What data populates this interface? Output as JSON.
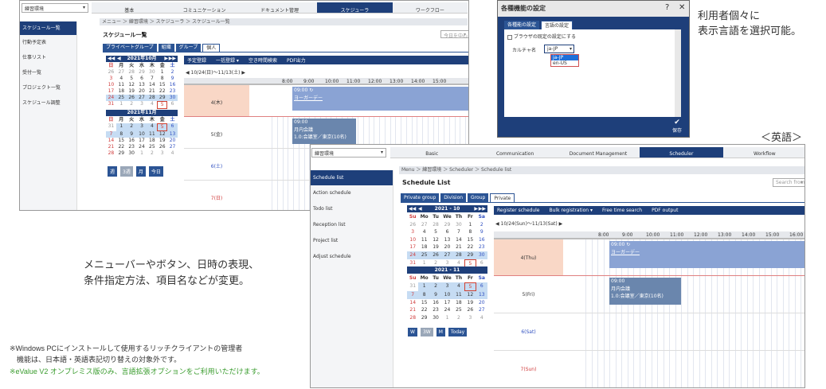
{
  "jp": {
    "select_value": "練習環境",
    "nav": [
      "基本",
      "コミュニケーション",
      "ドキュメント管理",
      "スケジューラ",
      "ワークフロー"
    ],
    "nav_active": 3,
    "side": [
      "スケジュール一覧",
      "行動予定表",
      "仕事リスト",
      "受付一覧",
      "プロジェクト一覧",
      "スケジュール調整"
    ],
    "breadcrumb": "メニュー ＞ 練習環境 ＞ スケジューラ ＞ スケジュール一覧",
    "title": "スケジュール一覧",
    "search_placeholder": "今日を中心",
    "tabs": [
      "プライベートグループ",
      "組織",
      "グループ",
      "個人"
    ],
    "toolbar": [
      "予定登録",
      "一括登録 ▾",
      "空き時間検索",
      "PDF出力"
    ],
    "range": "10/24(日)〜11/13(土)",
    "month1": "2021年10月",
    "month2": "2021年11月",
    "dow": [
      "日",
      "月",
      "火",
      "水",
      "木",
      "金",
      "土"
    ],
    "view_buttons": [
      "週",
      "3週",
      "月",
      "今日"
    ],
    "hours": [
      "8:00",
      "9:00",
      "10:00",
      "11:00",
      "12:00",
      "13:00",
      "14:00",
      "15:00"
    ],
    "days": [
      "4(木)",
      "5(金)",
      "6(土)",
      "7(日)"
    ],
    "ev1_time": "09:00",
    "ev1_text": "ヨーガーデー",
    "ev2_time": "09:00",
    "ev2_title": "月内会議",
    "ev2_room": "1.0:会議室／東京(10名)"
  },
  "en": {
    "select_value": "練習環境",
    "nav": [
      "Basic",
      "Communication",
      "Document Management",
      "Scheduler",
      "Workflow"
    ],
    "nav_active": 3,
    "side": [
      "Schedule list",
      "Action schedule",
      "Todo list",
      "Reception list",
      "Project list",
      "Adjust schedule"
    ],
    "breadcrumb": "Menu ＞ 練習環境 ＞ Scheduler ＞ Schedule list",
    "title": "Schedule List",
    "search_placeholder": "Search from",
    "tabs": [
      "Private group",
      "Division",
      "Group",
      "Private"
    ],
    "toolbar": [
      "Register schedule",
      "Bulk registration ▾",
      "Free time search",
      "PDF output"
    ],
    "range": "10/24(Sun)〜11/13(Sat)",
    "month1": "2021 - 10",
    "month2": "2021 - 11",
    "dow": [
      "Su",
      "Mo",
      "Tu",
      "We",
      "Th",
      "Fr",
      "Sa"
    ],
    "view_buttons": [
      "W",
      "3W",
      "M",
      "Today"
    ],
    "hours": [
      "8:00",
      "9:00",
      "10:00",
      "11:00",
      "12:00",
      "13:00",
      "14:00",
      "15:00",
      "16:00"
    ],
    "days": [
      "4(Thu)",
      "5(Fri)",
      "6(Sat)",
      "7(Sun)"
    ],
    "ev1_time": "09:00",
    "ev1_text": "ヨーガーデー",
    "ev2_time": "09:00",
    "ev2_title": "月内会議",
    "ev2_room": "1.0:会議室／東京(10名)"
  },
  "oct": [
    "26",
    "27",
    "28",
    "29",
    "30",
    "1",
    "2",
    "3",
    "4",
    "5",
    "6",
    "7",
    "8",
    "9",
    "10",
    "11",
    "12",
    "13",
    "14",
    "15",
    "16",
    "17",
    "18",
    "19",
    "20",
    "21",
    "22",
    "23",
    "24",
    "25",
    "26",
    "27",
    "28",
    "29",
    "30",
    "31",
    "1",
    "2",
    "3",
    "4",
    "5",
    "6"
  ],
  "nov": [
    "31",
    "1",
    "2",
    "3",
    "4",
    "5",
    "6",
    "7",
    "8",
    "9",
    "10",
    "11",
    "12",
    "13",
    "14",
    "15",
    "16",
    "17",
    "18",
    "19",
    "20",
    "21",
    "22",
    "23",
    "24",
    "25",
    "26",
    "27",
    "28",
    "29",
    "30",
    "1",
    "2",
    "3",
    "4"
  ],
  "dialog": {
    "title": "各種機能の設定",
    "help": "?",
    "close": "✕",
    "tabs": [
      "各種能の設定",
      "言語の設定"
    ],
    "checkbox_label": "ブラウザの既定の設定にする",
    "culture_label": "カルチャ名",
    "culture_value": "ja-JP",
    "options": [
      "ja-JP",
      "en-US"
    ],
    "save_label": "保存"
  },
  "captions": {
    "right1": "利用者個々に",
    "right2": "表示言語を選択可能。",
    "english": "＜英語＞",
    "mid1": "メニューバーやボタン、日時の表現、",
    "mid2": "条件指定方法、項目名などが変更。",
    "note1": "※Windows PCにインストールして使用するリッチクライアントの管理者",
    "note2": "　機能は、日本語・英語表記切り替えの対象外です。",
    "note3": "※eValue V2 オンプレミス版のみ、言語拡張オプションをご利用いただけます。"
  },
  "colors": {
    "primary": "#1e3f7a",
    "event": "#8aa3d4",
    "event2": "#6a86ad",
    "today": "#f9d7c6",
    "note_green": "#3a9c2e"
  }
}
